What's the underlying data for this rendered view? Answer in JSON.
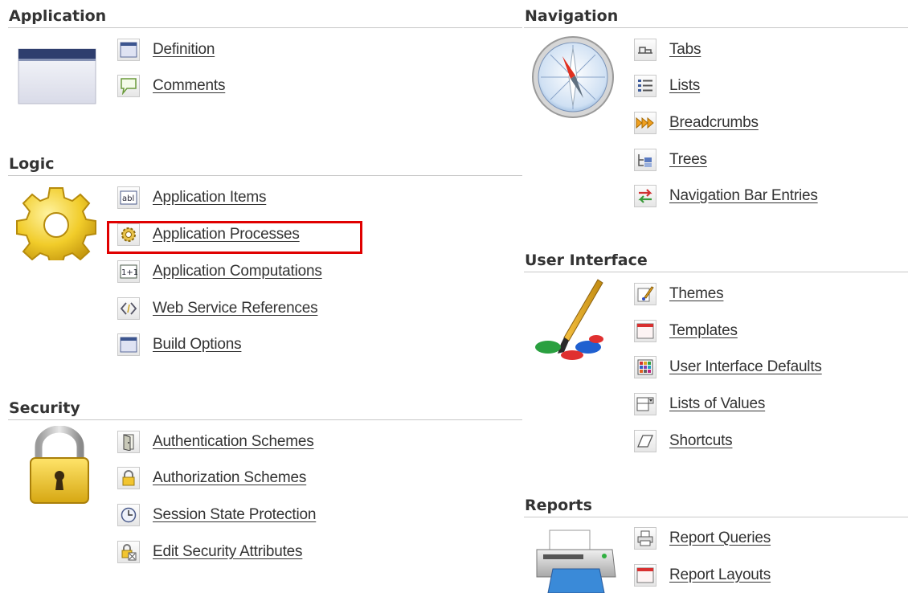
{
  "application": {
    "title": "Application",
    "items": [
      {
        "label": "Definition",
        "icon": "window-icon"
      },
      {
        "label": "Comments",
        "icon": "speech-bubble-icon"
      }
    ]
  },
  "logic": {
    "title": "Logic",
    "items": [
      {
        "label": "Application Items",
        "icon": "text-field-icon"
      },
      {
        "label": "Application Processes",
        "icon": "gear-icon"
      },
      {
        "label": "Application Computations",
        "icon": "calculation-icon"
      },
      {
        "label": "Web Service References",
        "icon": "code-brackets-icon"
      },
      {
        "label": "Build Options",
        "icon": "window-icon"
      }
    ],
    "highlighted_item": "Application Processes"
  },
  "security": {
    "title": "Security",
    "items": [
      {
        "label": "Authentication Schemes",
        "icon": "door-icon"
      },
      {
        "label": "Authorization Schemes",
        "icon": "lock-icon"
      },
      {
        "label": "Session State Protection",
        "icon": "clock-icon"
      },
      {
        "label": "Edit Security Attributes",
        "icon": "lock-edit-icon"
      }
    ]
  },
  "navigation": {
    "title": "Navigation",
    "items": [
      {
        "label": "Tabs",
        "icon": "tabs-icon"
      },
      {
        "label": "Lists",
        "icon": "list-icon"
      },
      {
        "label": "Breadcrumbs",
        "icon": "breadcrumb-arrows-icon"
      },
      {
        "label": "Trees",
        "icon": "tree-icon"
      },
      {
        "label": "Navigation Bar Entries",
        "icon": "swap-arrows-icon"
      }
    ]
  },
  "user_interface": {
    "title": "User Interface",
    "items": [
      {
        "label": "Themes",
        "icon": "paintbrush-icon"
      },
      {
        "label": "Templates",
        "icon": "template-icon"
      },
      {
        "label": "User Interface Defaults",
        "icon": "color-grid-icon"
      },
      {
        "label": "Lists of Values",
        "icon": "dropdown-list-icon"
      },
      {
        "label": "Shortcuts",
        "icon": "shortcut-icon"
      }
    ]
  },
  "reports": {
    "title": "Reports",
    "items": [
      {
        "label": "Report Queries",
        "icon": "printer-icon"
      },
      {
        "label": "Report Layouts",
        "icon": "template-icon"
      }
    ]
  },
  "colors": {
    "highlight": "#e00000",
    "text": "#333333",
    "rule": "#c8c8c8"
  }
}
